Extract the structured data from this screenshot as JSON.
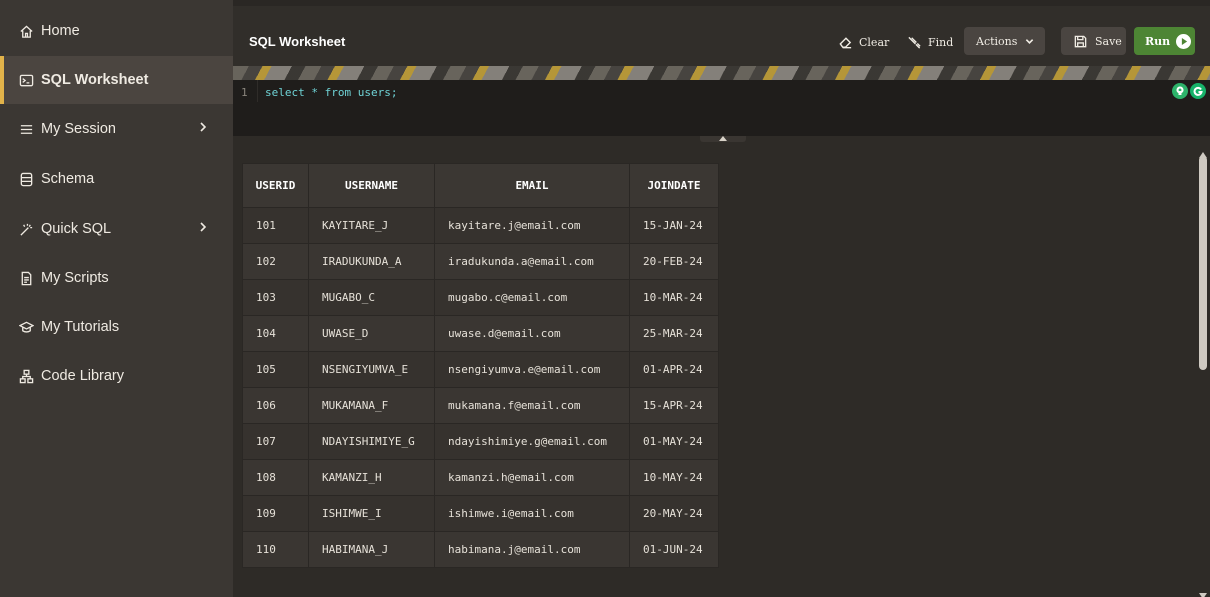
{
  "sidebar": {
    "items": [
      {
        "label": "Home",
        "icon": "home-icon"
      },
      {
        "label": "SQL Worksheet",
        "icon": "terminal-icon",
        "active": true
      },
      {
        "label": "My Session",
        "icon": "menu-lines-icon",
        "has_submenu": true
      },
      {
        "label": "Schema",
        "icon": "database-icon"
      },
      {
        "label": "Quick SQL",
        "icon": "magic-wand-icon",
        "has_submenu": true
      },
      {
        "label": "My Scripts",
        "icon": "document-icon"
      },
      {
        "label": "My Tutorials",
        "icon": "graduation-cap-icon"
      },
      {
        "label": "Code Library",
        "icon": "hierarchy-icon"
      }
    ]
  },
  "header": {
    "title": "SQL Worksheet",
    "clear_label": "Clear",
    "find_label": "Find",
    "actions_label": "Actions",
    "save_label": "Save",
    "run_label": "Run"
  },
  "editor": {
    "line_number": "1",
    "code": "select * from users;"
  },
  "results": {
    "columns": [
      "USERID",
      "USERNAME",
      "EMAIL",
      "JOINDATE"
    ],
    "rows": [
      [
        "101",
        "KAYITARE_J",
        "kayitare.j@email.com",
        "15-JAN-24"
      ],
      [
        "102",
        "IRADUKUNDA_A",
        "iradukunda.a@email.com",
        "20-FEB-24"
      ],
      [
        "103",
        "MUGABO_C",
        "mugabo.c@email.com",
        "10-MAR-24"
      ],
      [
        "104",
        "UWASE_D",
        "uwase.d@email.com",
        "25-MAR-24"
      ],
      [
        "105",
        "NSENGIYUMVA_E",
        "nsengiyumva.e@email.com",
        "01-APR-24"
      ],
      [
        "106",
        "MUKAMANA_F",
        "mukamana.f@email.com",
        "15-APR-24"
      ],
      [
        "107",
        "NDAYISHIMIYE_G",
        "ndayishimiye.g@email.com",
        "01-MAY-24"
      ],
      [
        "108",
        "KAMANZI_H",
        "kamanzi.h@email.com",
        "10-MAY-24"
      ],
      [
        "109",
        "ISHIMWE_I",
        "ishimwe.i@email.com",
        "20-MAY-24"
      ],
      [
        "110",
        "HABIMANA_J",
        "habimana.j@email.com",
        "01-JUN-24"
      ]
    ]
  },
  "colors": {
    "accent_active": "#e2b34a",
    "run_button": "#4d8534",
    "sql_text": "#6fd3d6"
  }
}
